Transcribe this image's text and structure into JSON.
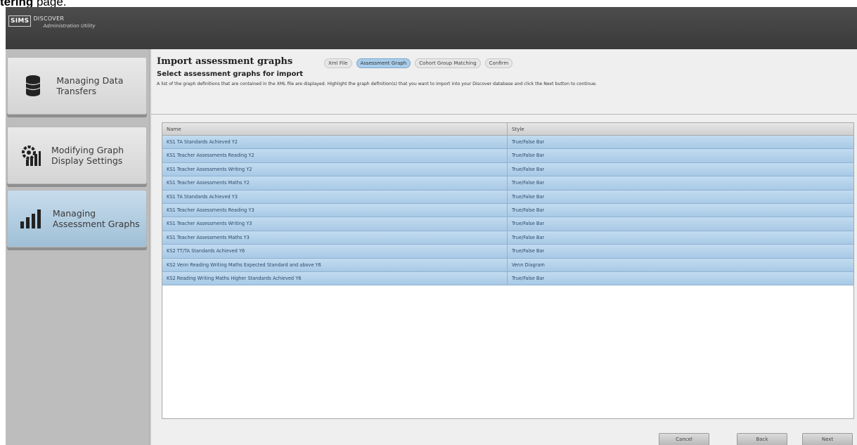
{
  "caption": {
    "prefix": "tering",
    "suffix": " page."
  },
  "app": {
    "logo_badge": "SIMS",
    "logo_title": "DISCOVER",
    "logo_subtitle": "Administration Utility"
  },
  "sidebar": {
    "items": [
      {
        "label": "Managing Data Transfers",
        "icon": "database-icon",
        "active": false
      },
      {
        "label": "Modifying Graph Display Settings",
        "icon": "chart-gear-icon",
        "active": false
      },
      {
        "label": "Managing Assessment Graphs",
        "icon": "bar-chart-icon",
        "active": true
      }
    ]
  },
  "main": {
    "title": "Import assessment graphs",
    "subtitle": "Select assessment graphs for import",
    "description": "A list of the graph definitions that are contained in the XML file are displayed. Highlight the graph definition(s) that you want to import into your Discover database and click the Next button to continue.",
    "steps": [
      "Xml File",
      "Assessment Graph",
      "Cohort Group Matching",
      "Confirm"
    ],
    "active_step": 1
  },
  "grid": {
    "columns": [
      "Name",
      "Style"
    ],
    "rows": [
      {
        "name": "KS1 TA Standards Achieved Y2",
        "style": "True/False Bar"
      },
      {
        "name": "KS1 Teacher Assessments Reading Y2",
        "style": "True/False Bar"
      },
      {
        "name": "KS1 Teacher Assessments Writing Y2",
        "style": "True/False Bar"
      },
      {
        "name": "KS1 Teacher Assessments Maths Y2",
        "style": "True/False Bar"
      },
      {
        "name": "KS1 TA Standards Achieved Y3",
        "style": "True/False Bar"
      },
      {
        "name": "KS1 Teacher Assessments Reading Y3",
        "style": "True/False Bar"
      },
      {
        "name": "KS1 Teacher Assessments Writing Y3",
        "style": "True/False Bar"
      },
      {
        "name": "KS1 Teacher Assessments Maths Y3",
        "style": "True/False Bar"
      },
      {
        "name": "KS2 TT/TA Standards Achieved Y6",
        "style": "True/False Bar"
      },
      {
        "name": "KS2 Venn Reading Writing Maths Expected Standard and above Y6",
        "style": "Venn Diagram"
      },
      {
        "name": "KS2 Reading Writing Maths Higher Standards Achieved Y6",
        "style": "True/False Bar"
      }
    ]
  },
  "footer": {
    "cancel": "Cancel",
    "back": "Back",
    "next": "Next"
  },
  "colors": {
    "titlebar": "#3f3f3f",
    "row_selected": "#b4d2ea",
    "active_nav": "#a9c6dc"
  }
}
